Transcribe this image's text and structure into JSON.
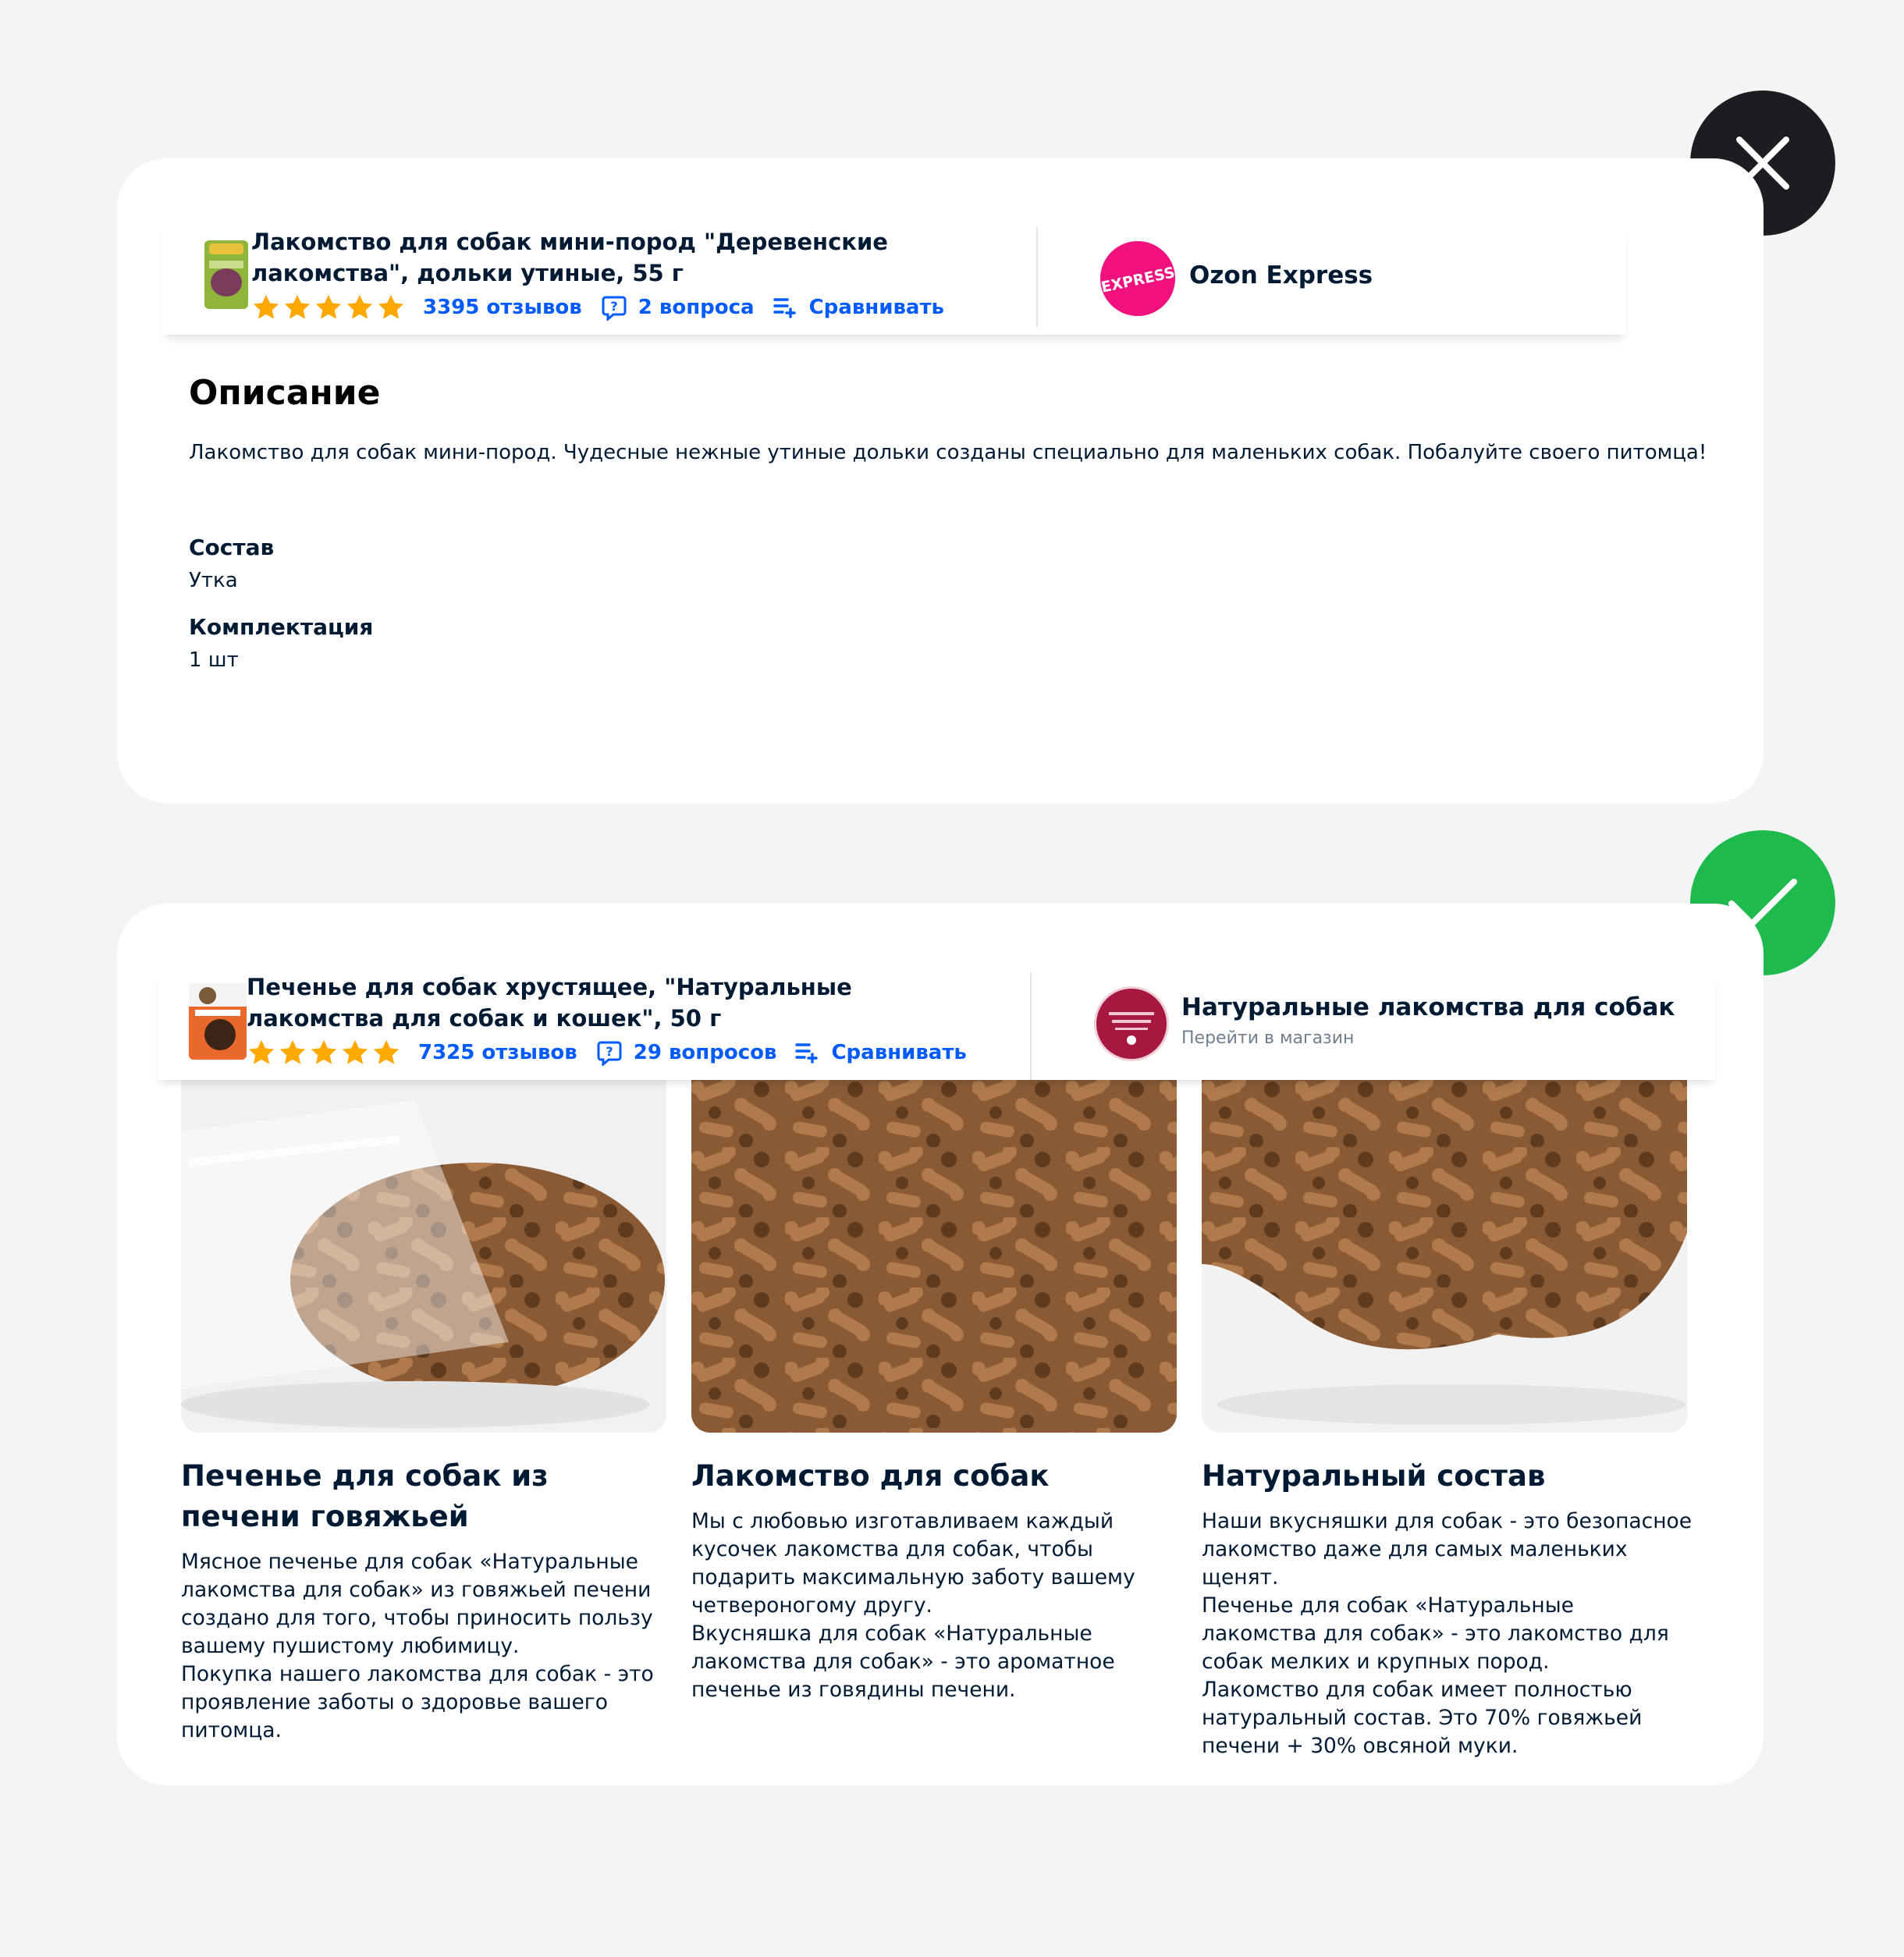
{
  "bad_example": {
    "product": {
      "title": "Лакомство для собак мини-пород \"Деревенские лакомства\", дольки утиные, 55 г",
      "rating_stars": 5,
      "reviews": "3395 отзывов",
      "questions": "2 вопроса",
      "compare": "Сравнивать"
    },
    "seller": {
      "logo_text": "EXPRESS",
      "name": "Ozon Express"
    },
    "description": {
      "heading": "Описание",
      "text": "Лакомство для собак мини-пород. Чудесные нежные утиные дольки созданы специально для маленьких собак. Побалуйте своего питомца!"
    },
    "attributes": [
      {
        "name": "Состав",
        "value": "Утка"
      },
      {
        "name": "Комплектация",
        "value": "1 шт"
      }
    ]
  },
  "good_example": {
    "product": {
      "title": "Печенье для собак хрустящее, \"Натуральные лакомства для собак и кошек\", 50 г",
      "rating_stars": 5,
      "reviews": "7325 отзывов",
      "questions": "29 вопросов",
      "compare": "Сравнивать"
    },
    "seller": {
      "name": "Натуральные лакомства для собак",
      "link": "Перейти в магазин"
    },
    "columns": [
      {
        "title": "Печенье для собак из печени говяжьей",
        "text": "Мясное печенье для собак «Натуральные лакомства для собак» из говяжьей печени создано для того, чтобы приносить пользу вашему пушистому любимицу.\nПокупка нашего лакомства для собак - это проявление заботы о здоровье вашего питомца."
      },
      {
        "title": "Лакомство для собак",
        "text": "Мы с любовью изготавливаем каждый кусочек лакомства для собак, чтобы подарить максимальную заботу вашему четвероногому другу.\nВкусняшка для собак «Натуральные лакомства для собак» - это ароматное печенье из говядины печени."
      },
      {
        "title": "Натуральный состав",
        "text": "Наши вкусняшки для собак - это безопасное лакомство даже для самых маленьких щенят.\nПеченье для собак «Натуральные лакомства для собак» - это лакомство для собак мелких и крупных пород.\nЛакомство для собак имеет полностью натуральный состав. Это 70% говяжьей печени + 30% овсяной муки."
      }
    ]
  },
  "colors": {
    "background": "#f3f4f6",
    "link_blue": "#005bff",
    "star_orange": "#ffa800",
    "bad_badge": "#1b1d21",
    "good_badge": "#1fba4d",
    "express_pink": "#f1117e"
  },
  "icons": {
    "bad_badge": "close-icon",
    "good_badge": "check-icon",
    "questions": "question-bubble-icon",
    "compare": "compare-list-icon",
    "rating": "star-icon"
  }
}
